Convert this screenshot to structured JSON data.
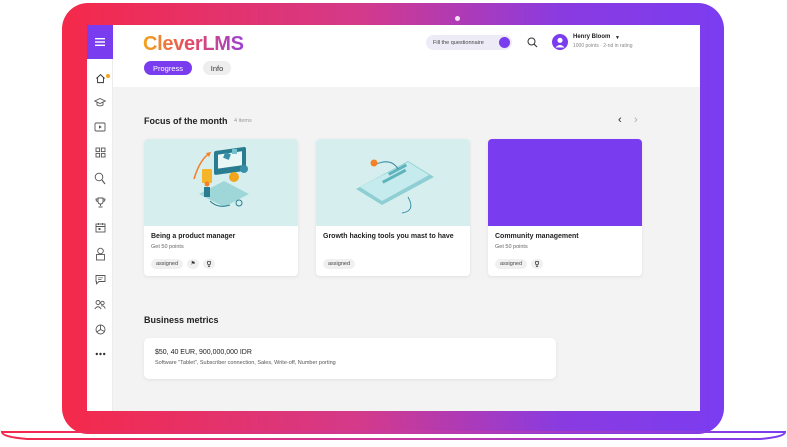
{
  "header": {
    "logo": "CleverLMS",
    "tabs": [
      {
        "label": "Progress",
        "active": true
      },
      {
        "label": "Info",
        "active": false
      }
    ],
    "questionnaire_label": "Fill the questionnaire",
    "user": {
      "name": "Henry Bloom",
      "meta": "1000 points · 2-nd in rating"
    }
  },
  "sidebar": {
    "icons": [
      "menu-icon",
      "home-icon",
      "graduation-cap-icon",
      "video-icon",
      "grid-icon",
      "search-person-icon",
      "trophy-icon",
      "calendar-icon",
      "certificate-icon",
      "chat-icon",
      "users-icon",
      "chart-icon",
      "more-icon"
    ]
  },
  "focus": {
    "title": "Focus of the month",
    "count": "4 items",
    "cards": [
      {
        "title": "Being a product manager",
        "subtitle": "Get 50 points",
        "tags": [
          "assigned"
        ],
        "icons": [
          "flag-icon",
          "trophy-icon"
        ],
        "image": "illustration-teal"
      },
      {
        "title": "Growth hacking tools you mast to have",
        "subtitle": "",
        "tags": [
          "assigned"
        ],
        "icons": [],
        "image": "illustration-phone"
      },
      {
        "title": "Community management",
        "subtitle": "Get 50 points",
        "tags": [
          "assigned"
        ],
        "icons": [
          "trophy-icon"
        ],
        "image": "solid-purple"
      }
    ]
  },
  "metrics": {
    "title": "Business metrics",
    "value": "$50, 40 EUR, 900,000,000 IDR",
    "description": "Software \"Tablet\", Subscriber connection, Sales, Write-off, Number porting"
  },
  "colors": {
    "accent": "#7a3cef",
    "frame_start": "#f5294a",
    "frame_end": "#7b3cf0",
    "illustration_bg": "#d6efee"
  }
}
